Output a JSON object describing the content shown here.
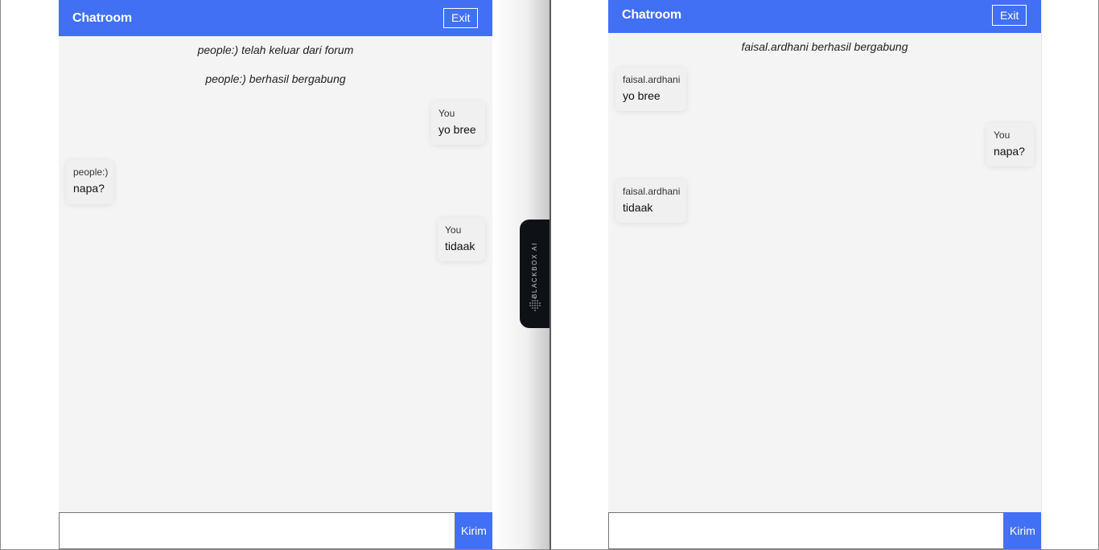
{
  "colors": {
    "header": "#4170f4",
    "chat_bg": "#f4f4f4",
    "send_button": "#4170f4"
  },
  "left_window": {
    "header": {
      "title": "Chatroom",
      "exit_label": "Exit"
    },
    "system_messages": [
      "people:) telah keluar dari forum",
      "people:) berhasil bergabung"
    ],
    "messages": [
      {
        "sender": "You",
        "text": "yo bree",
        "side": "right"
      },
      {
        "sender": "people:)",
        "text": "napa?",
        "side": "left"
      },
      {
        "sender": "You",
        "text": "tidaak",
        "side": "right"
      }
    ],
    "input": {
      "value": "",
      "placeholder": ""
    },
    "send_label": "Kirim"
  },
  "right_window": {
    "header": {
      "title": "Chatroom",
      "exit_label": "Exit"
    },
    "system_messages": [
      "faisal.ardhani berhasil bergabung"
    ],
    "messages": [
      {
        "sender": "faisal.ardhani",
        "text": "yo bree",
        "side": "left"
      },
      {
        "sender": "You",
        "text": "napa?",
        "side": "right"
      },
      {
        "sender": "faisal.ardhani",
        "text": "tidaak",
        "side": "left"
      }
    ],
    "input": {
      "value": "",
      "placeholder": ""
    },
    "send_label": "Kirim"
  },
  "blackbox_tab": {
    "label": "BLACKBOX AI",
    "icon": "blackbox-logo-icon"
  }
}
